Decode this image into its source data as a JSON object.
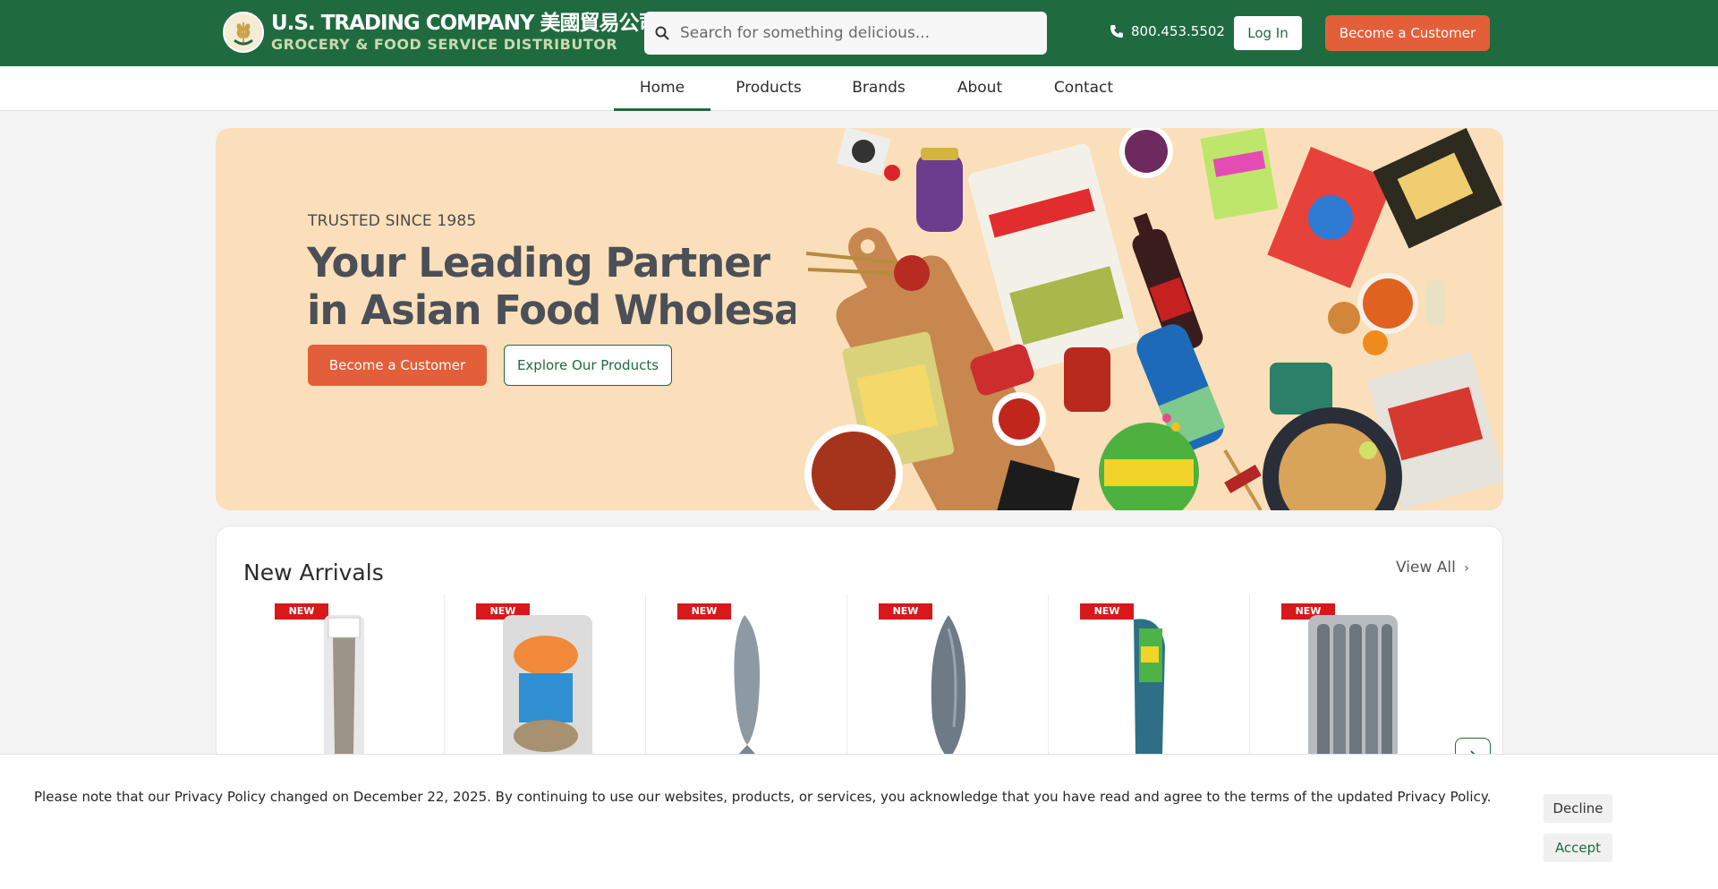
{
  "header": {
    "logo_line1": "U.S. TRADING COMPANY 美國貿易公司",
    "logo_line2": "GROCERY & FOOD SERVICE DISTRIBUTOR",
    "search_placeholder": "Search for something delicious...",
    "phone": "800.453.5502",
    "login_label": "Log In",
    "become_label": "Become a Customer",
    "brand_green": "#1f6b3f",
    "accent_orange": "#e35f3a"
  },
  "nav": {
    "items": [
      "Home",
      "Products",
      "Brands",
      "About",
      "Contact"
    ],
    "active": "Home"
  },
  "hero": {
    "eyebrow": "TRUSTED SINCE 1985",
    "title_line1": "Your Leading Partner",
    "title_line2": "in Asian Food Wholesale",
    "primary_btn": "Become a Customer",
    "secondary_btn": "Explore Our Products"
  },
  "arrivals": {
    "title": "New Arrivals",
    "view_all": "View All",
    "badge": "NEW",
    "products": [
      {
        "kind": "bagged-fish-tall"
      },
      {
        "kind": "bagged-fish-platter"
      },
      {
        "kind": "whole-fish"
      },
      {
        "kind": "whole-tuna"
      },
      {
        "kind": "labeled-fish"
      },
      {
        "kind": "fish-pack"
      }
    ]
  },
  "cookie": {
    "text": "Please note that our Privacy Policy changed on December 22, 2025. By continuing to use our websites, products, or services, you acknowledge that you have read and agree to the terms of the updated Privacy Policy.",
    "decline": "Decline",
    "accept": "Accept"
  }
}
